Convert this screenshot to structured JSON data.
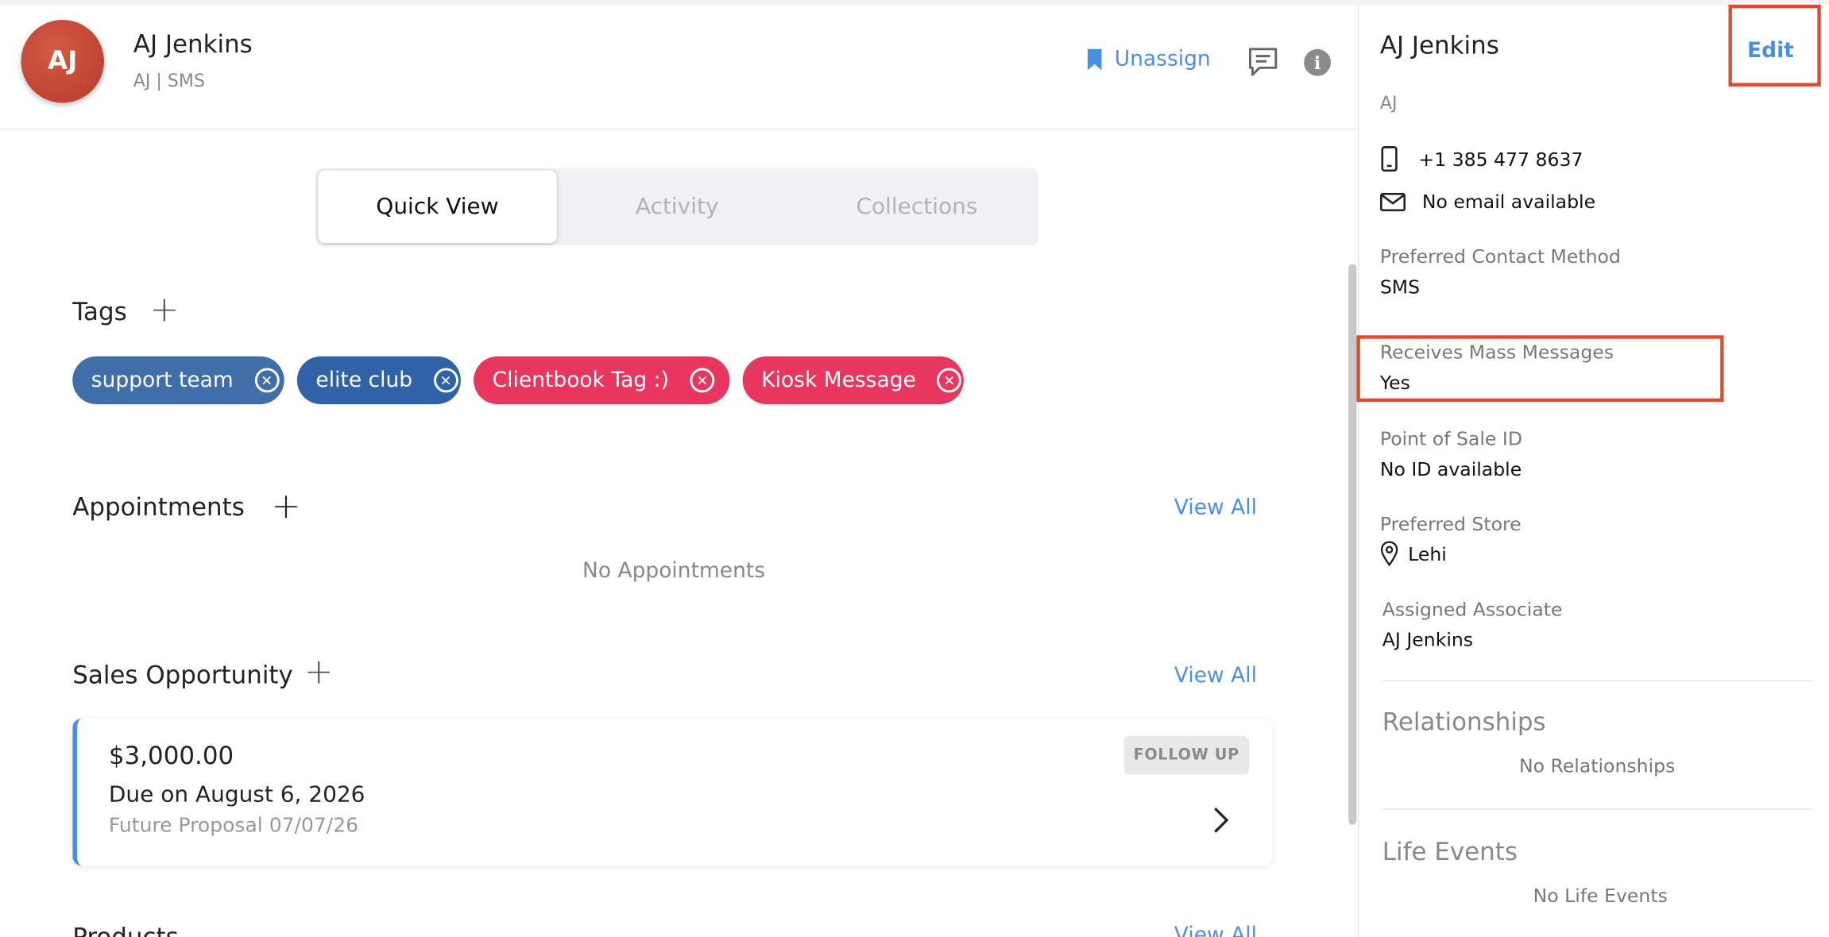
{
  "header": {
    "avatar_initials": "AJ",
    "client_name": "AJ Jenkins",
    "client_subtitle": "AJ | SMS",
    "unassign_label": "Unassign",
    "info_label": "i"
  },
  "tabs": [
    {
      "label": "Quick View",
      "active": true
    },
    {
      "label": "Activity",
      "active": false
    },
    {
      "label": "Collections",
      "active": false
    }
  ],
  "tags_section": {
    "title": "Tags",
    "add_label": "+",
    "tags": [
      {
        "label": "support team",
        "color": "#3f6ea8"
      },
      {
        "label": "elite club",
        "color": "#2f62a6"
      },
      {
        "label": "Clientbook Tag :)",
        "color": "#e8365f"
      },
      {
        "label": "Kiosk Message",
        "color": "#e8365f"
      }
    ],
    "remove_symbol": "✕"
  },
  "appointments": {
    "title": "Appointments",
    "add_label": "+",
    "view_all": "View All",
    "empty_text": "No Appointments"
  },
  "sales_opportunity": {
    "title": "Sales Opportunity",
    "add_label": "+",
    "view_all": "View All",
    "card": {
      "amount": "$3,000.00",
      "due": "Due on August 6, 2026",
      "description": "Future Proposal 07/07/26",
      "badge": "FOLLOW UP"
    }
  },
  "next_section": {
    "title": "Products",
    "view_all": "View All"
  },
  "right_panel": {
    "name": "AJ Jenkins",
    "edit_label": "Edit",
    "initials": "AJ",
    "phone": "+1 385 477 8637",
    "email": "No email available",
    "fields": {
      "preferred_contact_label": "Preferred Contact Method",
      "preferred_contact_value": "SMS",
      "mass_messages_label": "Receives Mass Messages",
      "mass_messages_value": "Yes",
      "pos_id_label": "Point of Sale ID",
      "pos_id_value": "No ID available",
      "preferred_store_label": "Preferred Store",
      "preferred_store_value": "Lehi",
      "assigned_associate_label": "Assigned Associate",
      "assigned_associate_value": "AJ Jenkins"
    },
    "relationships": {
      "title": "Relationships",
      "empty": "No Relationships"
    },
    "life_events": {
      "title": "Life Events",
      "empty": "No Life Events"
    }
  },
  "colors": {
    "accent": "#4a90e2",
    "avatar": "#c4432f",
    "highlight": "#e24a2e",
    "tag_blue": "#3f6ea8",
    "tag_pink": "#e8365f"
  },
  "icons": [
    "bookmark-icon",
    "chat-icon",
    "info-icon",
    "phone-icon",
    "mail-icon",
    "location-pin-icon",
    "chevron-right-icon",
    "close-circle-icon",
    "plus-icon"
  ]
}
